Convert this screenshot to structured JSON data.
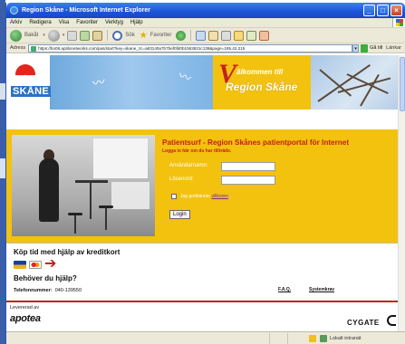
{
  "window": {
    "title": "Region Skåne - Microsoft Internet Explorer",
    "minimize": "_",
    "maximize": "□",
    "close": "×"
  },
  "menu": [
    "Arkiv",
    "Redigera",
    "Visa",
    "Favoriter",
    "Verktyg",
    "Hjälp"
  ],
  "toolbar": {
    "back_label": "Bakåt",
    "search_label": "Sök",
    "favorites_label": "Favoriter"
  },
  "addressbar": {
    "label": "Adress",
    "url": "https://bo06.aptilonetworks.com/pas/start?key=skane_zc=a63140a7b7bef0fd0b1563631c138&page=195.42.215",
    "go_label": "Gå till",
    "links_label": "Länkar"
  },
  "banner": {
    "logo_text": "SKÅNE",
    "welcome_line1": "älkommen till",
    "welcome_line2": "Region Skåne",
    "welcome_v": "V"
  },
  "login": {
    "title": "Patientsurf - Region Skånes patientportal för Internet",
    "subtitle": "Logga in här om du har tillträde.",
    "username_label": "Användarnamn:",
    "password_label": "Lösenord:",
    "terms_prefix": "Jag godkänner ",
    "terms_link": "villkoren",
    "button": "Login"
  },
  "lower": {
    "buy_title": "Köp tid med hjälp av kreditkort",
    "help_title": "Behöver du hjälp?",
    "phone_label": "Telefonnummer:",
    "phone_value": "040-139550",
    "faq_link": "F.A.Q.",
    "sys_link": "Systemkrav",
    "supplied_by": "Levererad av",
    "apoteket": "apotea",
    "cygate": "CYGATE"
  },
  "statusbar": {
    "zone": "Lokalt intranät"
  },
  "colors": {
    "band_yellow": "#f2c20e",
    "accent_red": "#c62010",
    "title_blue": "#1c54d6"
  }
}
